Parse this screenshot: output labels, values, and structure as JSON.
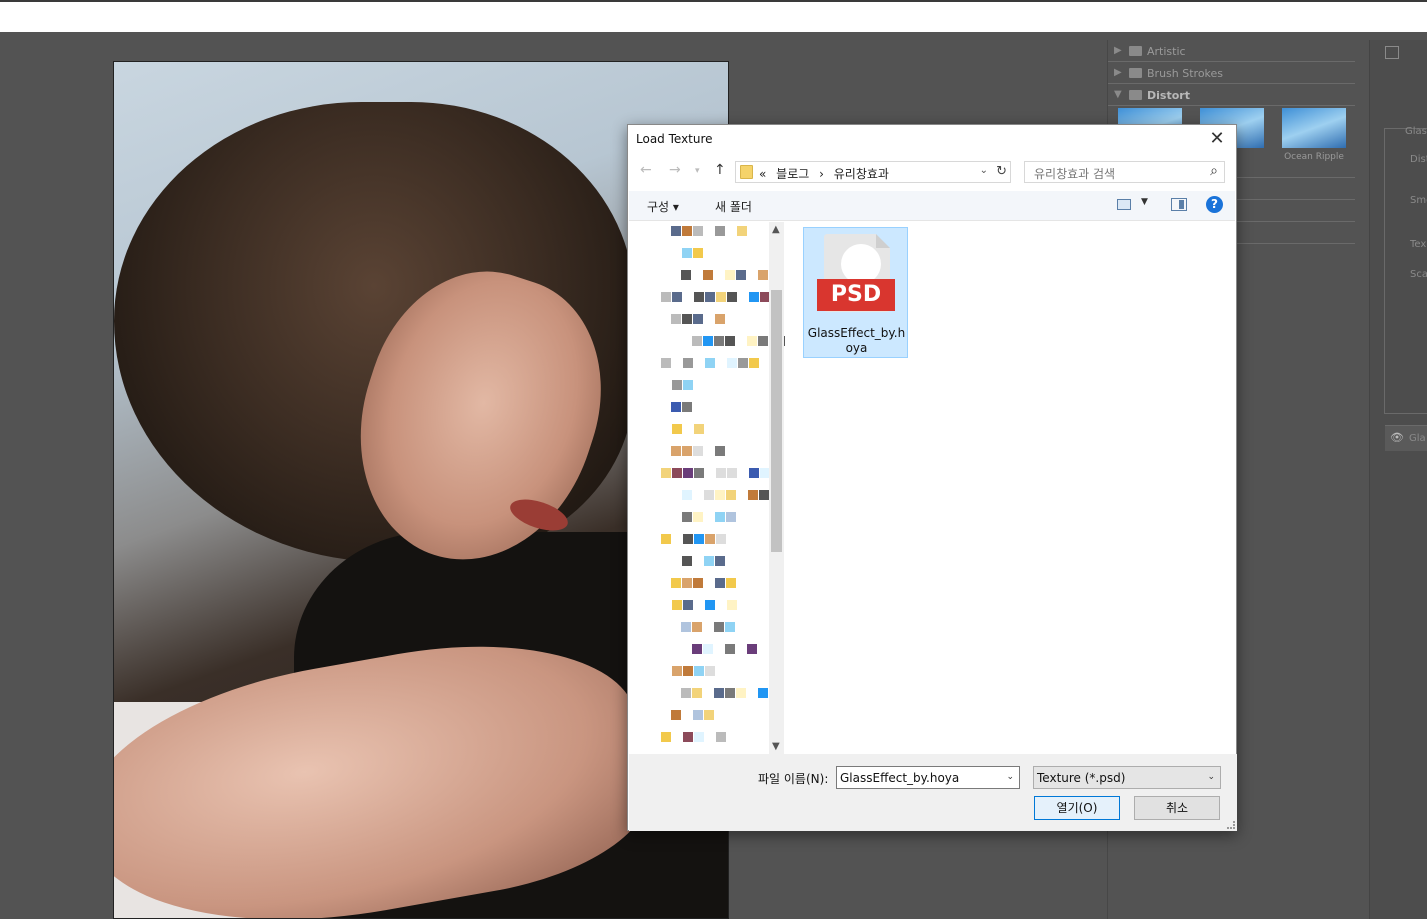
{
  "filter_panel": {
    "categories": [
      {
        "label": "Artistic",
        "expanded": false
      },
      {
        "label": "Brush Strokes",
        "expanded": false
      },
      {
        "label": "Distort",
        "expanded": true
      }
    ],
    "thumb_labels": [
      "Ocean Ripple"
    ],
    "side_labels": [
      "Glass",
      "Dist",
      "Smo",
      "Tex",
      "Sca",
      "Gla"
    ]
  },
  "dialog": {
    "title": "Load Texture",
    "close_glyph": "✕",
    "address": {
      "prefix": "«",
      "crumb1": "블로그",
      "sep": "›",
      "crumb2": "유리창효과"
    },
    "search_placeholder": "유리창효과 검색",
    "toolbar": {
      "organize": "구성 ▾",
      "new_folder": "새 폴더",
      "help": "?"
    },
    "files": [
      {
        "name": "GlassEffect_by.hoya",
        "badge": "PSD",
        "selected": true
      }
    ],
    "bottom": {
      "filename_label": "파일 이름(N):",
      "filename_value": "GlassEffect_by.hoya",
      "filetype_value": "Texture (*.psd)",
      "open_label": "열기(O)",
      "cancel_label": "취소"
    }
  },
  "colors": {
    "workspace": "#535353",
    "accent": "#0078d7",
    "psd_badge": "#d9362f",
    "selection": "#cce8ff"
  }
}
